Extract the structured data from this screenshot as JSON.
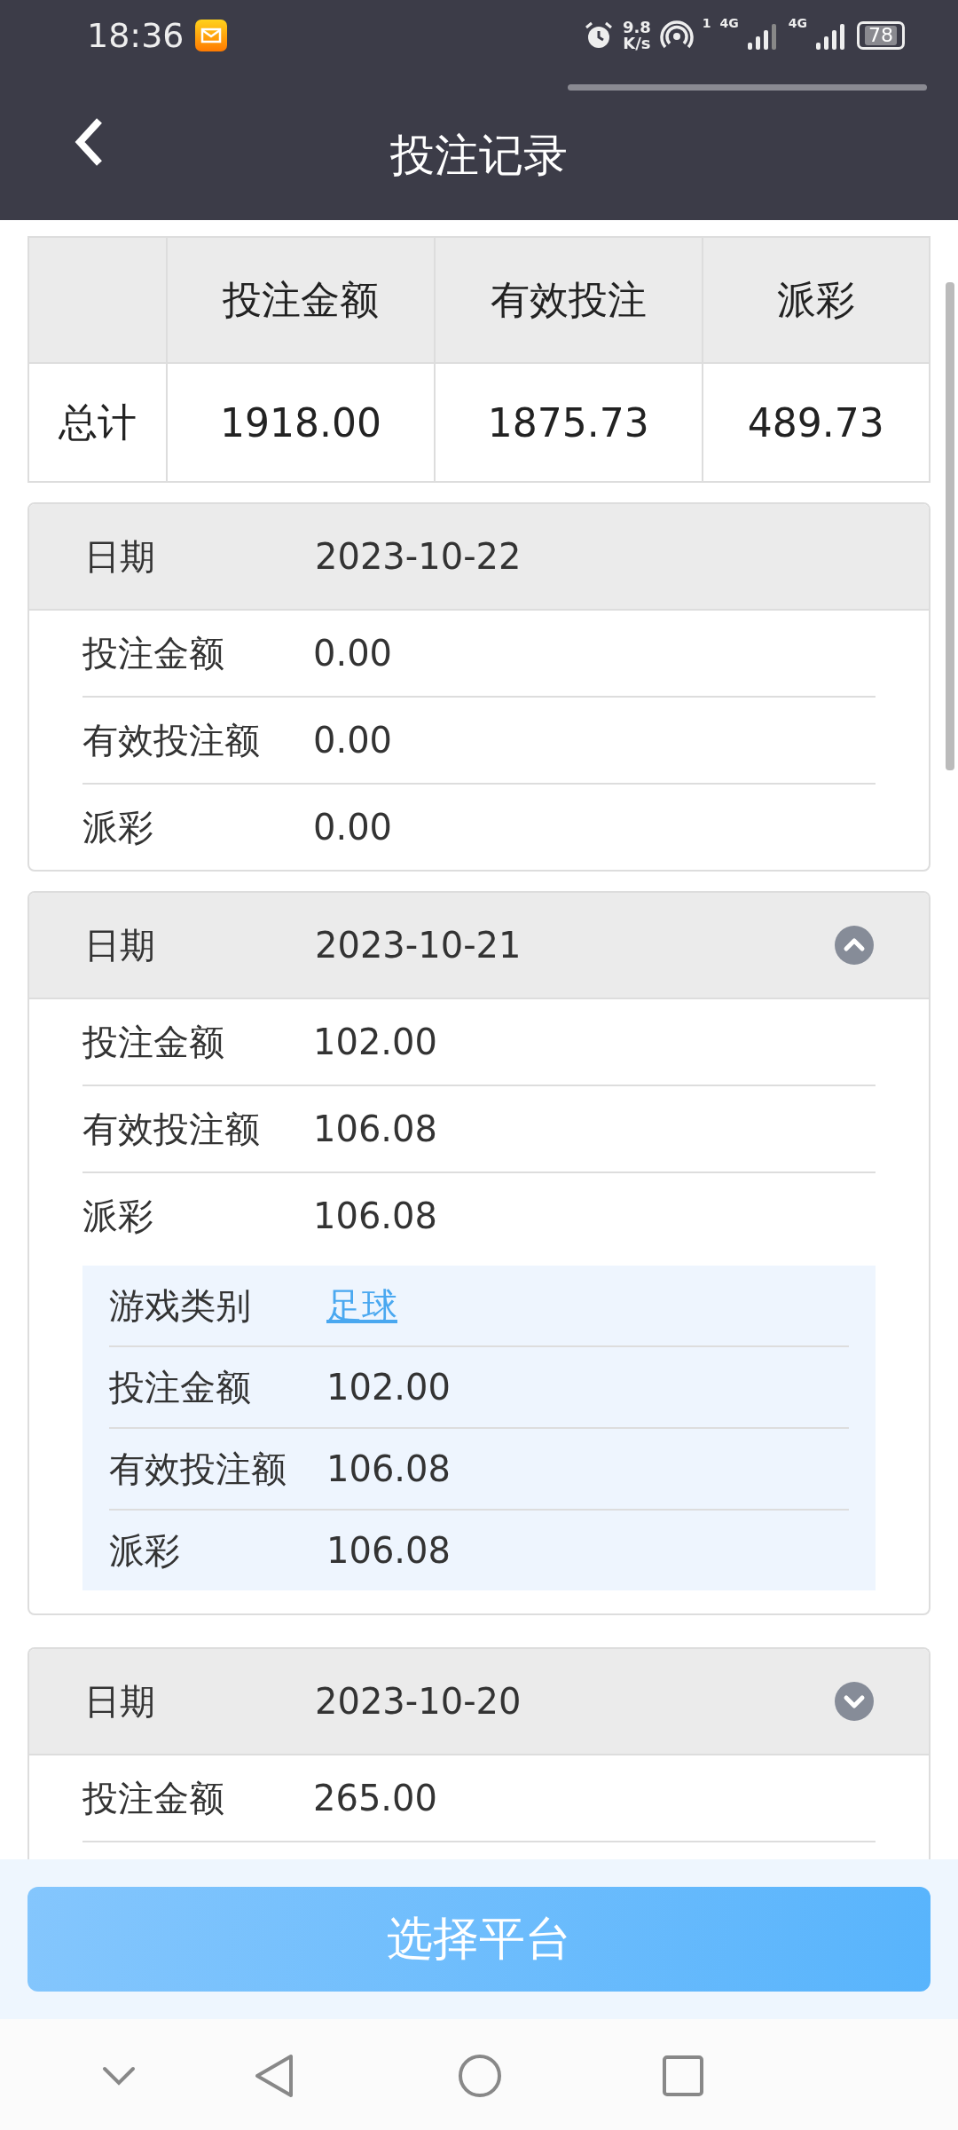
{
  "status_bar": {
    "time": "18:36",
    "net_speed": [
      "9.8",
      "K/s"
    ],
    "sim_1": "1",
    "network_1": "4G",
    "network_2": "4G",
    "battery": "78"
  },
  "header": {
    "title": "投注记录"
  },
  "summary": {
    "columns": [
      "投注金额",
      "有效投注",
      "派彩"
    ],
    "rows": [
      {
        "label": "总计",
        "values": [
          "1918.00",
          "1875.73",
          "489.73"
        ]
      }
    ]
  },
  "records": [
    {
      "date_label": "日期",
      "date": "2023-10-22",
      "items": [
        {
          "label": "投注金额",
          "value": "0.00"
        },
        {
          "label": "有效投注额",
          "value": "0.00"
        },
        {
          "label": "派彩",
          "value": "0.00"
        }
      ]
    },
    {
      "date_label": "日期",
      "date": "2023-10-21",
      "expanded": true,
      "items": [
        {
          "label": "投注金额",
          "value": "102.00"
        },
        {
          "label": "有效投注额",
          "value": "106.08"
        },
        {
          "label": "派彩",
          "value": "106.08"
        }
      ],
      "games": [
        {
          "label": "游戏类别",
          "value": "足球",
          "items": [
            {
              "label": "投注金额",
              "value": "102.00"
            },
            {
              "label": "有效投注额",
              "value": "106.08"
            },
            {
              "label": "派彩",
              "value": "106.08"
            }
          ]
        }
      ]
    },
    {
      "date_label": "日期",
      "date": "2023-10-20",
      "expanded": false,
      "items": [
        {
          "label": "投注金额",
          "value": "265.00"
        }
      ]
    }
  ],
  "bottom_button": "选择平台"
}
